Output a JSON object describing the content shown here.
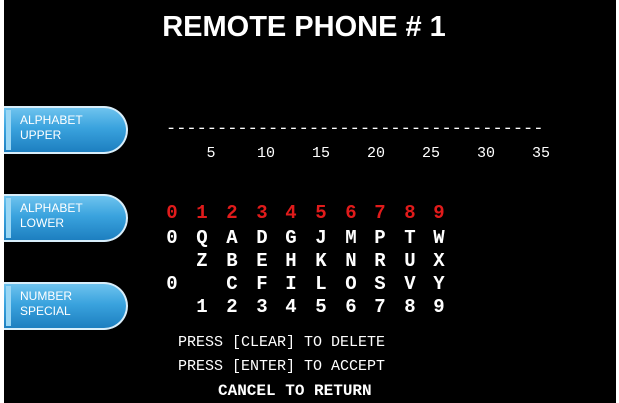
{
  "title": "REMOTE PHONE # 1",
  "soft_keys": [
    {
      "line1": "ALPHABET",
      "line2": "UPPER"
    },
    {
      "line1": "ALPHABET",
      "line2": "LOWER"
    },
    {
      "line1": "NUMBER",
      "line2": "SPECIAL"
    }
  ],
  "entry_line": "-------------------------------------",
  "ruler": [
    "5",
    "10",
    "15",
    "20",
    "25",
    "30",
    "35"
  ],
  "key_headers": [
    "0",
    "1",
    "2",
    "3",
    "4",
    "5",
    "6",
    "7",
    "8",
    "9"
  ],
  "key_rows": [
    [
      "0",
      "Q",
      "A",
      "D",
      "G",
      "J",
      "M",
      "P",
      "T",
      "W"
    ],
    [
      "",
      "Z",
      "B",
      "E",
      "H",
      "K",
      "N",
      "R",
      "U",
      "X"
    ],
    [
      "0",
      "",
      "C",
      "F",
      "I",
      "L",
      "O",
      "S",
      "V",
      "Y"
    ],
    [
      "",
      "1",
      "2",
      "3",
      "4",
      "5",
      "6",
      "7",
      "8",
      "9"
    ]
  ],
  "messages": {
    "clear": "PRESS [CLEAR] TO DELETE",
    "enter": "PRESS [ENTER] TO ACCEPT",
    "cancel": "CANCEL TO RETURN"
  },
  "colors": {
    "background": "#000000",
    "text": "#ffffff",
    "header_digits": "#e11b1b",
    "soft_key": "#3aa3de"
  }
}
